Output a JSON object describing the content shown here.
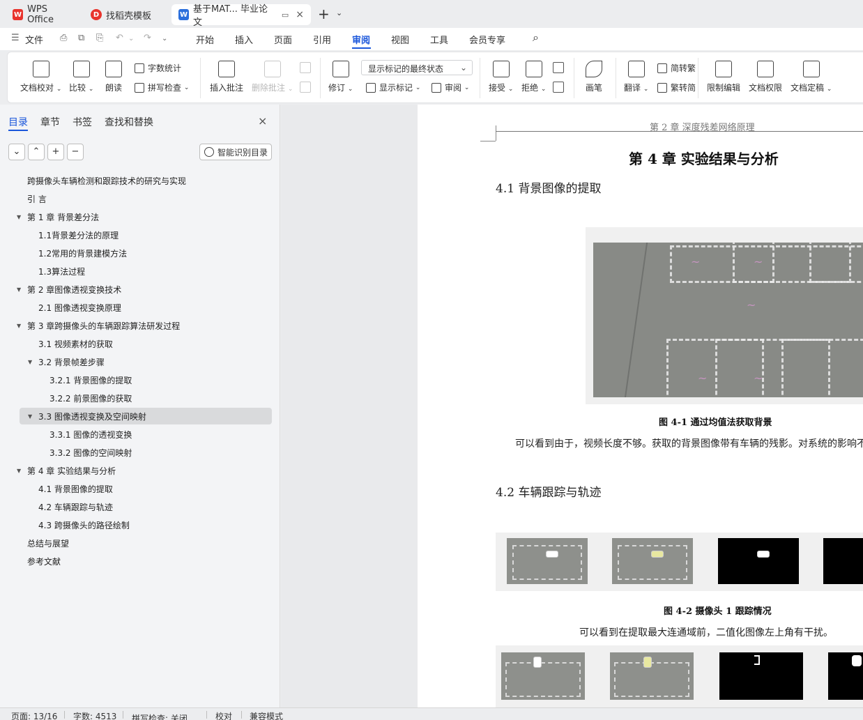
{
  "titlebar": {
    "tabs": [
      {
        "label": "WPS Office",
        "logo": "W"
      },
      {
        "label": "找稻壳模板",
        "logo": "D"
      },
      {
        "label": "基于MAT... 毕业论文",
        "logo": "W"
      }
    ],
    "new_tab": "+",
    "chevron": "⌄",
    "close": "×",
    "window_icon": "▭"
  },
  "menubar": {
    "menu_icon": "☰",
    "file": "文件",
    "items": [
      "开始",
      "插入",
      "页面",
      "引用",
      "审阅",
      "视图",
      "工具",
      "会员专享"
    ],
    "active": "审阅",
    "search_icon": "⌕",
    "quick": [
      "⎙",
      "⧉",
      "⎘",
      "↶",
      "⌄",
      "↷",
      "⌄"
    ]
  },
  "ribbon": {
    "buttons": {
      "doc_check": "文档校对",
      "compare": "比较",
      "read_aloud": "朗读",
      "word_count": "字数统计",
      "spell_check": "拼写检查",
      "insert_comment": "插入批注",
      "delete_comment": "删除批注",
      "track": "修订",
      "show_markup": "显示标记",
      "review": "审阅",
      "accept": "接受",
      "reject": "拒绝",
      "pen": "画笔",
      "translate": "翻译",
      "to_traditional": "简转繁",
      "to_simplified": "繁转简",
      "restrict_edit": "限制编辑",
      "doc_permission": "文档权限",
      "doc_finalize": "文档定稿"
    },
    "markup_dropdown": "显示标记的最终状态",
    "chevron": "⌄"
  },
  "nav": {
    "tabs": [
      "目录",
      "章节",
      "书签",
      "查找和替换"
    ],
    "active_tab": "目录",
    "close": "×",
    "tools": [
      "⌄",
      "⌃",
      "+",
      "−"
    ],
    "smart_button": "智能识别目录",
    "toc": [
      {
        "text": "跨摄像头车辆检测和跟踪技术的研究与实现",
        "level": 0,
        "expand": ""
      },
      {
        "text": "引  言",
        "level": 0,
        "expand": ""
      },
      {
        "text": "第 1 章  背景差分法",
        "level": 0,
        "expand": "▼"
      },
      {
        "text": "1.1背景差分法的原理",
        "level": 1,
        "expand": ""
      },
      {
        "text": "1.2常用的背景建模方法",
        "level": 1,
        "expand": ""
      },
      {
        "text": "1.3算法过程",
        "level": 1,
        "expand": ""
      },
      {
        "text": "第 2 章图像透视变换技术",
        "level": 0,
        "expand": "▼"
      },
      {
        "text": "2.1 图像透视变换原理",
        "level": 1,
        "expand": ""
      },
      {
        "text": "第 3 章跨摄像头的车辆跟踪算法研发过程",
        "level": 0,
        "expand": "▼"
      },
      {
        "text": "3.1 视频素材的获取",
        "level": 1,
        "expand": ""
      },
      {
        "text": "3.2  背景帧差步骤",
        "level": 1,
        "expand": "▼"
      },
      {
        "text": "3.2.1 背景图像的提取",
        "level": 2,
        "expand": ""
      },
      {
        "text": "3.2.2 前景图像的获取",
        "level": 2,
        "expand": ""
      },
      {
        "text": "3.3  图像透视变换及空间映射",
        "level": 1,
        "expand": "▼"
      },
      {
        "text": "3.3.1 图像的透视变换",
        "level": 2,
        "expand": ""
      },
      {
        "text": "3.3.2 图像的空间映射",
        "level": 2,
        "expand": ""
      },
      {
        "text": "第 4 章  实验结果与分析",
        "level": 0,
        "expand": "▼"
      },
      {
        "text": "4.1  背景图像的提取",
        "level": 1,
        "expand": ""
      },
      {
        "text": "4.2  车辆跟踪与轨迹",
        "level": 1,
        "expand": ""
      },
      {
        "text": "4.3  跨摄像头的路径绘制",
        "level": 1,
        "expand": ""
      },
      {
        "text": "总结与展望",
        "level": 0,
        "expand": ""
      },
      {
        "text": "参考文献",
        "level": 0,
        "expand": ""
      }
    ],
    "selected_index": 13
  },
  "document": {
    "header": "第 2 章  深度残差网络原理",
    "chapter_title": "第 4 章  实验结果与分析",
    "sec1": "4.1  背景图像的提取",
    "fig1_caption": "图 4-1 通过均值法获取背景",
    "para1": "可以看到由于，视频长度不够。获取的背景图像带有车辆的残影。对系统的影响不",
    "sec2": "4.2  车辆跟踪与轨迹",
    "fig2_caption": "图 4-2 摄像头 1 跟踪情况",
    "para2": "可以看到在提取最大连通域前，二值化图像左上角有干扰。"
  },
  "statusbar": {
    "page": "页面: 13/16",
    "words": "字数: 4513",
    "spell": "拼写检查: 关闭",
    "proof": "校对",
    "compat": "兼容模式",
    "chevron": "⌄"
  },
  "colors": {
    "accent": "#1a56db",
    "wps_red": "#e8332c"
  }
}
